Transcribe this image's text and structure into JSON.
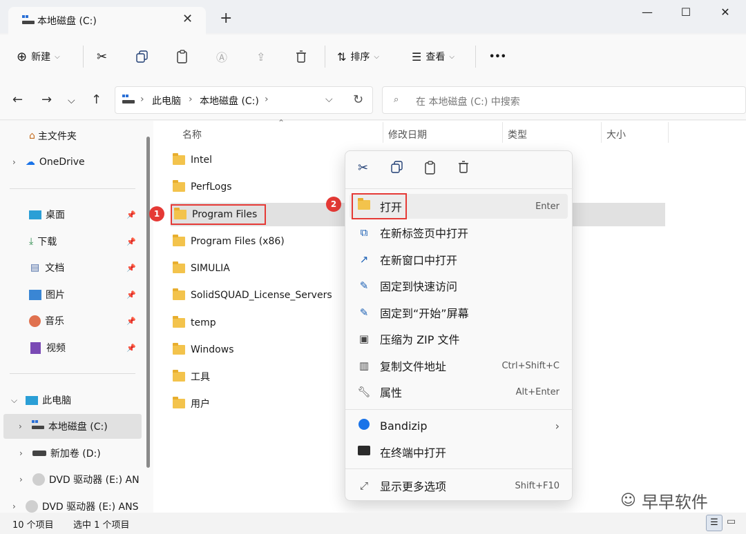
{
  "window": {
    "tab_title": "本地磁盘 (C:)",
    "tab_close": "✕",
    "new_tab": "+",
    "minimize": "—",
    "maximize": "☐",
    "close": "✕"
  },
  "toolbar": {
    "new_label": "新建",
    "sort_label": "排序",
    "view_label": "查看",
    "more": "•••"
  },
  "address": {
    "crumbs": [
      "此电脑",
      "本地磁盘 (C:)"
    ],
    "search_placeholder": "在 本地磁盘 (C:) 中搜索"
  },
  "sidebar": {
    "home": "主文件夹",
    "onedrive": "OneDrive",
    "quick": [
      {
        "label": "桌面",
        "icon": "desktop-icon"
      },
      {
        "label": "下载",
        "icon": "download-icon"
      },
      {
        "label": "文档",
        "icon": "document-icon"
      },
      {
        "label": "图片",
        "icon": "pictures-icon"
      },
      {
        "label": "音乐",
        "icon": "music-icon"
      },
      {
        "label": "视频",
        "icon": "video-icon"
      }
    ],
    "this_pc": "此电脑",
    "drives": [
      {
        "label": "本地磁盘 (C:)",
        "selected": true
      },
      {
        "label": "新加卷 (D:)"
      },
      {
        "label": "DVD 驱动器 (E:) AN"
      },
      {
        "label": "DVD 驱动器 (E:) ANS"
      }
    ]
  },
  "columns": {
    "name": "名称",
    "modified": "修改日期",
    "type": "类型",
    "size": "大小"
  },
  "files": [
    "Intel",
    "PerfLogs",
    "Program Files",
    "Program Files (x86)",
    "SIMULIA",
    "SolidSQUAD_License_Servers",
    "temp",
    "Windows",
    "工具",
    "用户"
  ],
  "annotations": {
    "step1": "1",
    "step2": "2"
  },
  "context_menu": {
    "items": [
      {
        "label": "打开",
        "key": "Enter"
      },
      {
        "label": "在新标签页中打开",
        "key": ""
      },
      {
        "label": "在新窗口中打开",
        "key": ""
      },
      {
        "label": "固定到快速访问",
        "key": ""
      },
      {
        "label": "固定到“开始”屏幕",
        "key": ""
      },
      {
        "label": "压缩为 ZIP 文件",
        "key": ""
      },
      {
        "label": "复制文件地址",
        "key": "Ctrl+Shift+C"
      },
      {
        "label": "属性",
        "key": "Alt+Enter"
      },
      {
        "label": "Bandizip",
        "key": "›"
      },
      {
        "label": "在终端中打开",
        "key": ""
      },
      {
        "label": "显示更多选项",
        "key": "Shift+F10"
      }
    ]
  },
  "status": {
    "count": "10 个项目",
    "selected": "选中 1 个项目"
  },
  "watermark": "早早软件",
  "colors": {
    "accent": "#e53935",
    "folder": "#f3c34c",
    "selection": "#e1e1e1"
  }
}
